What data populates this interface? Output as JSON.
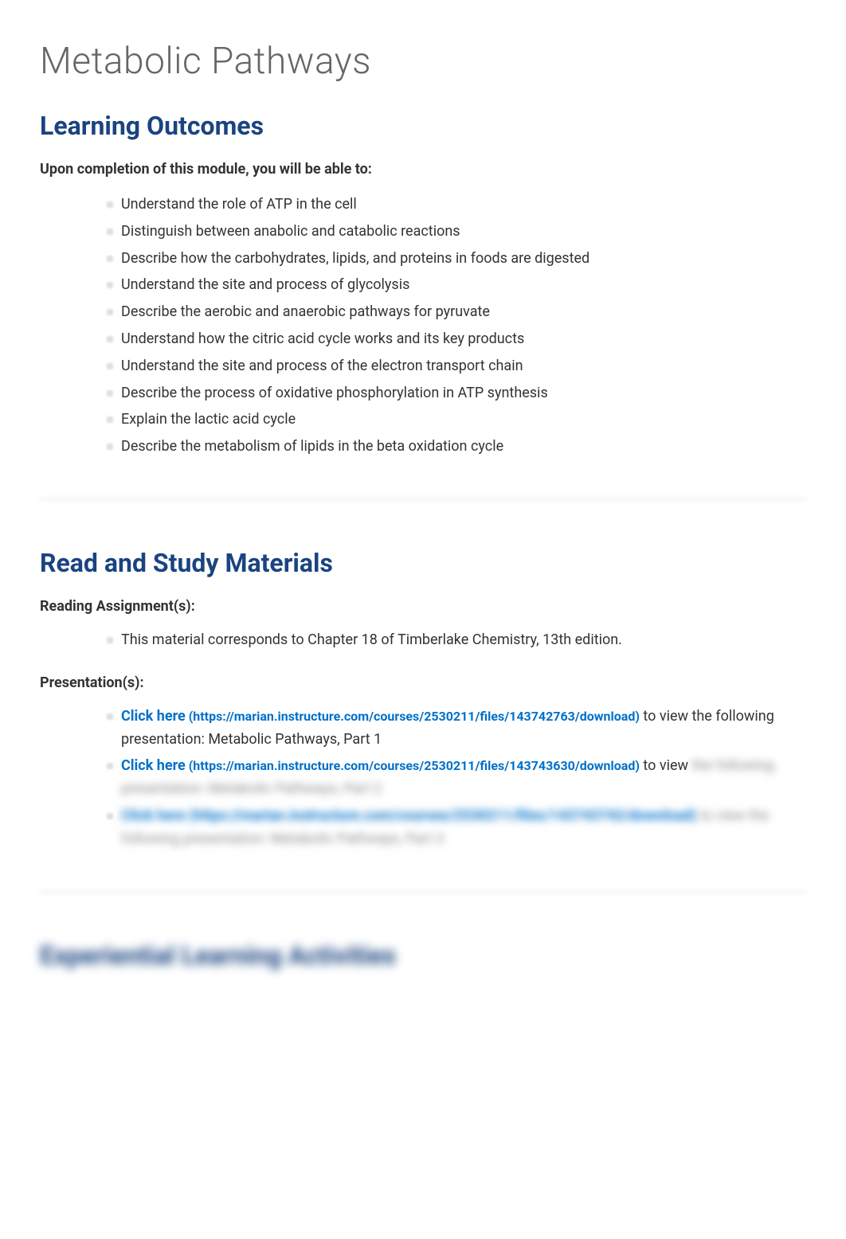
{
  "page_title": "Metabolic Pathways",
  "learning_outcomes": {
    "heading": "Learning Outcomes",
    "intro": "Upon completion of this module, you will be able to:",
    "items": [
      "Understand the role of ATP in the cell",
      "Distinguish between anabolic and catabolic reactions",
      "Describe how the carbohydrates, lipids, and proteins in foods are digested",
      "Understand the site and process of glycolysis",
      "Describe the aerobic and anaerobic pathways for pyruvate",
      "Understand how the citric acid cycle works and its key products",
      "Understand the site and process of the electron transport chain",
      "Describe the process of oxidative phosphorylation in ATP synthesis",
      "Explain the lactic acid cycle",
      "Describe the metabolism of lipids in the beta oxidation cycle"
    ]
  },
  "read_and_study": {
    "heading": "Read and Study Materials",
    "reading_subheading": "Reading Assignment(s):",
    "reading_items": [
      "This material corresponds to Chapter 18 of Timberlake Chemistry, 13th edition."
    ],
    "presentation_subheading": "Presentation(s):",
    "presentations": [
      {
        "link_text": "Click here",
        "url_display": " (https://marian.instructure.com/courses/2530211/files/143742763/download)",
        "tail": " to view the following presentation: Metabolic Pathways, Part 1"
      },
      {
        "link_text": "Click here",
        "url_display": " (https://marian.instructure.com/courses/2530211/files/143743630/download)",
        "tail_prefix": " to view",
        "tail_blurred": "the following presentation: Metabolic Pathways, Part 2"
      },
      {
        "link_text_blurred": "Click here (https://marian.instructure.com/courses/2530211/files/143743742/download)",
        "tail_blurred_prefix": " to view",
        "tail_blurred": "the following presentation: Metabolic Pathways, Part 3"
      }
    ]
  },
  "experiential": {
    "heading_blurred": "Experiential Learning Activities"
  }
}
